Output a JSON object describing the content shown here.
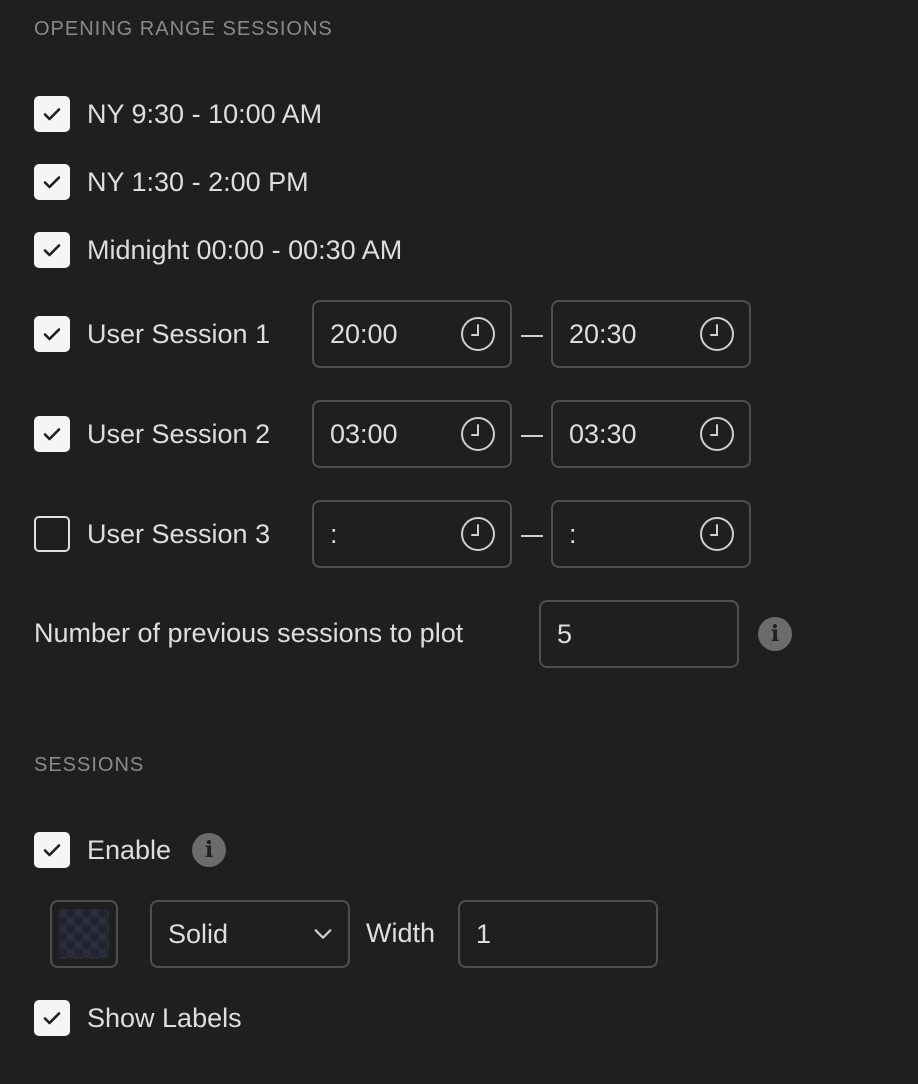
{
  "opening_range": {
    "title": "OPENING RANGE SESSIONS",
    "fixed_sessions": [
      {
        "label": "NY 9:30 - 10:00 AM",
        "checked": true
      },
      {
        "label": "NY 1:30 - 2:00 PM",
        "checked": true
      },
      {
        "label": "Midnight 00:00 - 00:30 AM",
        "checked": true
      }
    ],
    "user_sessions": [
      {
        "label": "User Session 1",
        "checked": true,
        "start": "20:00",
        "end": "20:30"
      },
      {
        "label": "User Session 2",
        "checked": true,
        "start": "03:00",
        "end": "03:30"
      },
      {
        "label": "User Session 3",
        "checked": false,
        "start": ":",
        "end": ":"
      }
    ],
    "previous_sessions": {
      "label": "Number of previous sessions to plot",
      "value": "5",
      "icon": "info-icon"
    }
  },
  "sessions": {
    "title": "SESSIONS",
    "enable": {
      "label": "Enable",
      "checked": true,
      "icon": "info-icon"
    },
    "line_style": {
      "selected": "Solid"
    },
    "width": {
      "label": "Width",
      "value": "1"
    },
    "show_labels": {
      "label": "Show Labels",
      "checked": true
    }
  },
  "icons": {
    "check": "check-icon",
    "clock": "clock-icon",
    "chevron": "chevron-down-icon",
    "info": "info-icon"
  }
}
